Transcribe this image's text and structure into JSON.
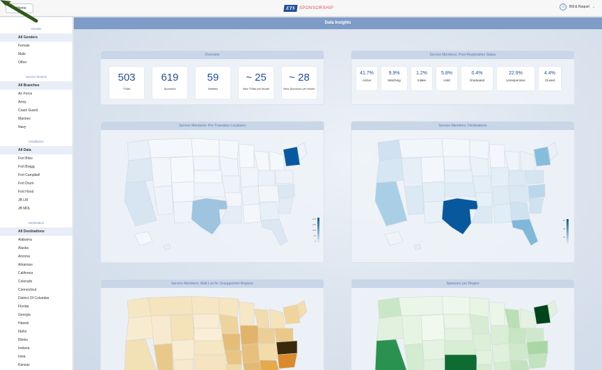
{
  "topbar": {
    "home_label": "Home",
    "brand_ets": "ETS",
    "brand_sponsorship": "SPONSORSHIP",
    "user_name": "Bill & Raquel"
  },
  "sidebar": {
    "gender": {
      "title": "Gender",
      "items": [
        "All Genders",
        "Female",
        "Male",
        "Other"
      ]
    },
    "branch": {
      "title": "Service Branch",
      "items": [
        "All Branches",
        "Air Force",
        "Army",
        "Coast Guard",
        "Marines",
        "Navy"
      ]
    },
    "installation": {
      "title": "Installation",
      "items": [
        "All Data",
        "Fort Bliss",
        "Fort Bragg",
        "Fort Campbell",
        "Fort Drum",
        "Fort Hood",
        "JB LM",
        "JB MDL"
      ]
    },
    "destination": {
      "title": "Destination",
      "items": [
        "All Destinations",
        "Alabama",
        "Alaska",
        "Arizona",
        "Arkansas",
        "California",
        "Colorado",
        "Connecticut",
        "District Of Columbia",
        "Florida",
        "Georgia",
        "Hawaii",
        "Idaho",
        "Illinois",
        "Indiana",
        "Iowa",
        "Kansas"
      ]
    }
  },
  "page_title": "Data Insights",
  "overview": {
    "title": "Overview",
    "tiles": [
      {
        "value": "503",
        "label": "TSMs"
      },
      {
        "value": "619",
        "label": "Sponsors"
      },
      {
        "value": "59",
        "label": "Waitees"
      },
      {
        "value": "~ 25",
        "label": "New TSMs per Month"
      },
      {
        "value": "~ 28",
        "label": "New Sponsors per Month"
      }
    ]
  },
  "status": {
    "title": "Service Members: Post-Registration Status",
    "items": [
      {
        "pct": "41.7%",
        "label": "Active"
      },
      {
        "pct": "9.9%",
        "label": "Matching"
      },
      {
        "pct": "1.2%",
        "label": "Intake"
      },
      {
        "pct": "5.8%",
        "label": "Hold"
      },
      {
        "pct": "0.4%",
        "label": "Graduated"
      },
      {
        "pct": "22.9%",
        "label": "Unresponsive"
      },
      {
        "pct": "4.4%",
        "label": "Closed"
      }
    ]
  },
  "maps": {
    "pre_transition": {
      "title": "Service Members: Pre-Transition Locations",
      "scale": [
        "200",
        "150",
        "100",
        "50",
        "0"
      ]
    },
    "destinations": {
      "title": "Service Members: Destinations",
      "scale": [
        "60",
        "40",
        "20"
      ]
    },
    "waitlist": {
      "title": "Service Members: Wait List for Unsupported Regions"
    },
    "sponsors": {
      "title": "Sponsors per Region"
    }
  },
  "colors": {
    "accent": "#1f4e96",
    "header_bar": "#7f9bc7",
    "blue_scale_dark": "#08589e",
    "orange_scale_dark": "#a04b08",
    "green_scale_dark": "#00441b"
  }
}
